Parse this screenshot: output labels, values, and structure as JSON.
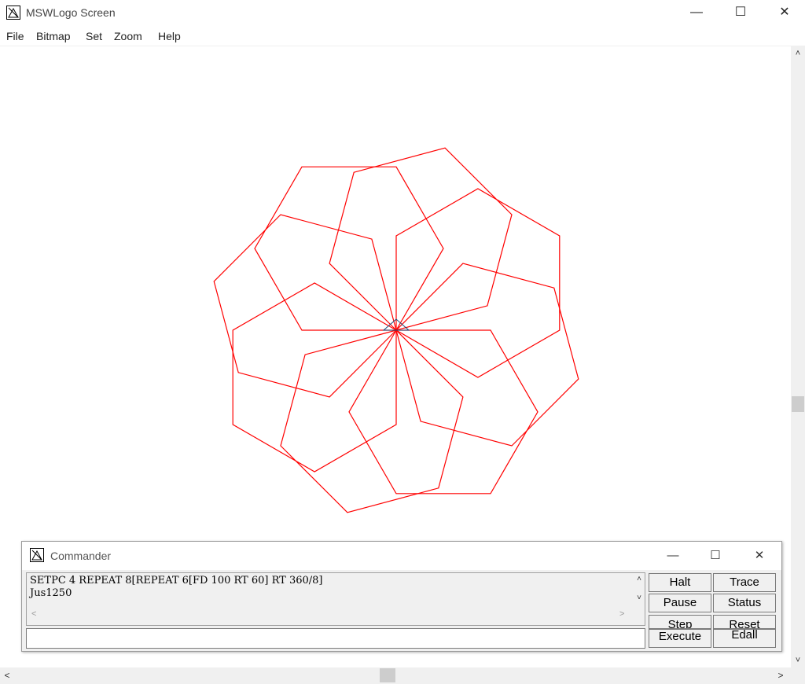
{
  "window": {
    "title": "MSWLogo Screen",
    "icon": "logo-app-icon",
    "controls": {
      "minimize": "—",
      "maximize": "☐",
      "close": "✕"
    }
  },
  "menu": [
    "File",
    "Bitmap",
    "Set",
    "Zoom",
    "Help"
  ],
  "drawing": {
    "pen_color": "#ff0000",
    "turtle_color": "#1a4a7a",
    "program": {
      "outer_repeat": 8,
      "inner_repeat": 6,
      "forward": 100,
      "inner_turn": 60,
      "outer_turn": 45
    }
  },
  "scroll": {
    "up": "˄",
    "down": "˅",
    "left": "<",
    "right": ">"
  },
  "commander": {
    "title": "Commander",
    "icon": "logo-app-icon",
    "controls": {
      "minimize": "—",
      "maximize": "☐",
      "close": "✕"
    },
    "history": [
      "SETPC 4 REPEAT 8[REPEAT 6[FD 100 RT 60] RT 360/8]",
      "Jus1250"
    ],
    "history_scroll": {
      "up": "˄",
      "down": "˅",
      "left": "<",
      "right": ">"
    },
    "input_value": "",
    "buttons": {
      "halt": "Halt",
      "trace": "Trace",
      "pause": "Pause",
      "status": "Status",
      "step": "Step",
      "reset": "Reset",
      "execute": "Execute",
      "edall": "Edall"
    }
  }
}
